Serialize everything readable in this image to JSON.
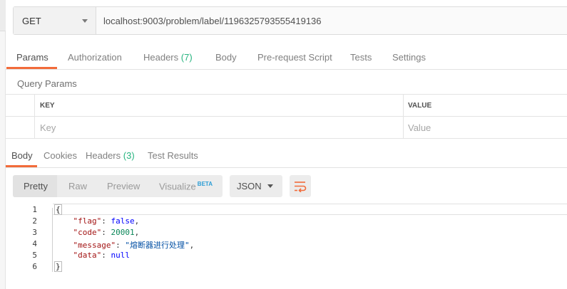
{
  "request": {
    "method": "GET",
    "url": "localhost:9003/problem/label/1196325793555419136"
  },
  "request_tabs": [
    {
      "label": "Params",
      "count": null
    },
    {
      "label": "Authorization",
      "count": null
    },
    {
      "label": "Headers",
      "count": "(7)"
    },
    {
      "label": "Body",
      "count": null
    },
    {
      "label": "Pre-request Script",
      "count": null
    },
    {
      "label": "Tests",
      "count": null
    },
    {
      "label": "Settings",
      "count": null
    }
  ],
  "query_params": {
    "title": "Query Params",
    "key_header": "KEY",
    "value_header": "VALUE",
    "key_placeholder": "Key",
    "value_placeholder": "Value"
  },
  "response_tabs": [
    {
      "label": "Body",
      "count": null
    },
    {
      "label": "Cookies",
      "count": null
    },
    {
      "label": "Headers",
      "count": "(3)"
    },
    {
      "label": "Test Results",
      "count": null
    }
  ],
  "view_modes": {
    "pretty": "Pretty",
    "raw": "Raw",
    "preview": "Preview",
    "visualize": "Visualize",
    "beta": "BETA"
  },
  "format": "JSON",
  "line_numbers": [
    "1",
    "2",
    "3",
    "4",
    "5",
    "6"
  ],
  "code": {
    "open": "{",
    "close": "}",
    "lines": [
      {
        "key": "\"flag\"",
        "value": "false",
        "comma": ","
      },
      {
        "key": "\"code\"",
        "value": "20001",
        "comma": ","
      },
      {
        "key": "\"message\"",
        "value": "\"熔断器进行处理\"",
        "comma": ","
      },
      {
        "key": "\"data\"",
        "value": "null",
        "comma": ""
      }
    ]
  },
  "colors": {
    "accent": "#f26b3a",
    "count_green": "#26b47f",
    "beta_blue": "#2d9ed6"
  },
  "icons": {
    "method_dropdown": "chevron-down-icon",
    "format_dropdown": "chevron-down-icon",
    "wrap": "wrap-lines-icon"
  }
}
